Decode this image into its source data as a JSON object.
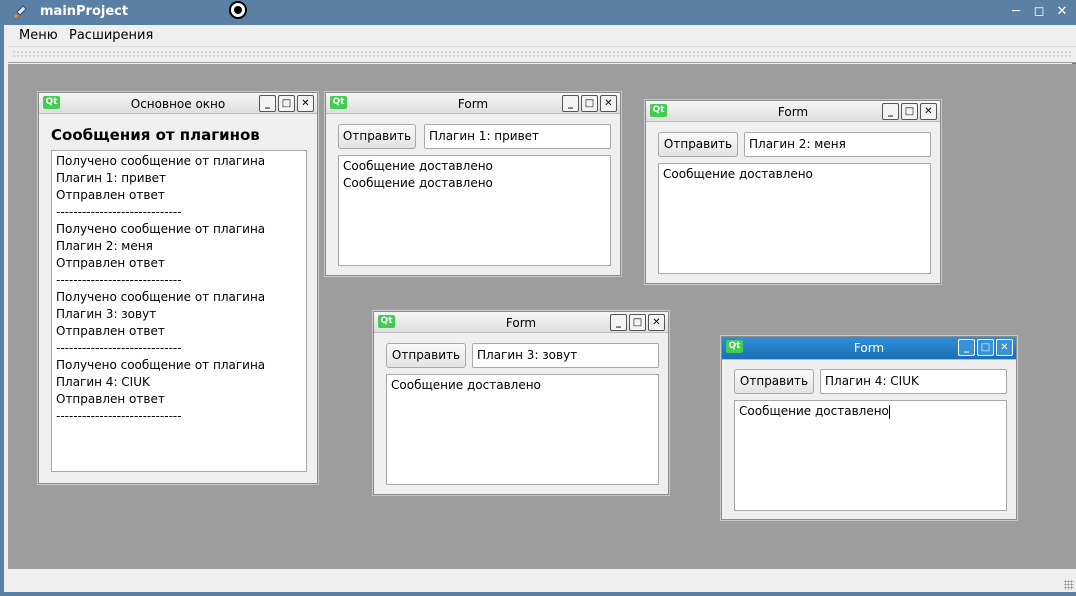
{
  "window": {
    "title": "mainProject"
  },
  "menubar": {
    "items": [
      "Меню",
      "Расширения"
    ]
  },
  "main_window": {
    "title": "Основное окно",
    "heading": "Сообщения от плагинов",
    "log_lines": [
      "Получено сообщение от плагина",
      "Плагин 1: привет",
      "Отправлен ответ",
      "-----------------------------",
      "Получено сообщение от плагина",
      "Плагин 2: меня",
      "Отправлен ответ",
      "-----------------------------",
      "Получено сообщение от плагина",
      "Плагин 3: зовут",
      "Отправлен ответ",
      "-----------------------------",
      "Получено сообщение от плагина",
      "Плагин 4: CIUK",
      "Отправлен ответ",
      "-----------------------------"
    ]
  },
  "forms": [
    {
      "title": "Form",
      "send_label": "Отправить",
      "input_value": "Плагин 1: привет",
      "messages": [
        "Сообщение доставлено",
        "Сообщение доставлено"
      ]
    },
    {
      "title": "Form",
      "send_label": "Отправить",
      "input_value": "Плагин 2: меня",
      "messages": [
        "Сообщение доставлено"
      ]
    },
    {
      "title": "Form",
      "send_label": "Отправить",
      "input_value": "Плагин 3: зовут",
      "messages": [
        "Сообщение доставлено"
      ]
    },
    {
      "title": "Form",
      "send_label": "Отправить",
      "input_value": "Плагин 4: CIUK",
      "messages": [
        "Сообщение доставлено"
      ]
    }
  ],
  "icons": {
    "subwindow_app_icon": "qt-logo-icon",
    "subwindow_icon_text": "Qt",
    "minimize": "minimize-icon",
    "maximize": "maximize-icon",
    "close": "close-icon"
  },
  "colors": {
    "titlebar": "#5a80a6",
    "active_subwindow": "#1b6fb9",
    "mdi_background": "#9d9d9d",
    "qt_green": "#41cd52"
  }
}
